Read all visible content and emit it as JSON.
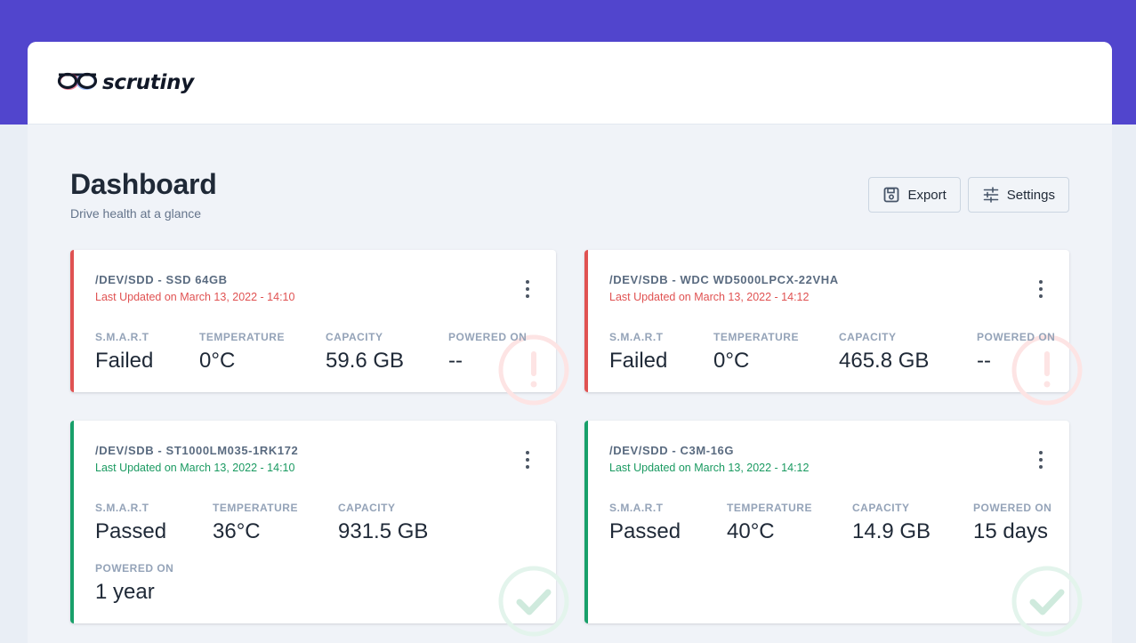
{
  "app": {
    "name": "scrutiny"
  },
  "page": {
    "title": "Dashboard",
    "subtitle": "Drive health at a glance"
  },
  "actions": {
    "export_label": "Export",
    "settings_label": "Settings"
  },
  "colors": {
    "brand": "#5145cd",
    "failed": "#e05252",
    "passed": "#18a06a"
  },
  "metric_labels": {
    "smart": "S.M.A.R.T",
    "temperature": "TEMPERATURE",
    "capacity": "CAPACITY",
    "powered_on": "POWERED ON"
  },
  "drives": [
    {
      "title": "/DEV/SDD - SSD 64GB",
      "updated": "Last Updated on March 13, 2022 - 14:10",
      "status": "failed",
      "smart": "Failed",
      "temperature": "0°C",
      "capacity": "59.6 GB",
      "powered_on": "--",
      "status_icon": "exclamation-icon"
    },
    {
      "title": "/DEV/SDB - WDC WD5000LPCX-22VHA",
      "updated": "Last Updated on March 13, 2022 - 14:12",
      "status": "failed",
      "smart": "Failed",
      "temperature": "0°C",
      "capacity": "465.8 GB",
      "powered_on": "--",
      "status_icon": "exclamation-icon"
    },
    {
      "title": "/DEV/SDB - ST1000LM035-1RK172",
      "updated": "Last Updated on March 13, 2022 - 14:10",
      "status": "passed",
      "smart": "Passed",
      "temperature": "36°C",
      "capacity": "931.5 GB",
      "powered_on": "1 year",
      "status_icon": "check-icon"
    },
    {
      "title": "/DEV/SDD - C3M-16G",
      "updated": "Last Updated on March 13, 2022 - 14:12",
      "status": "passed",
      "smart": "Passed",
      "temperature": "40°C",
      "capacity": "14.9 GB",
      "powered_on": "15 days",
      "status_icon": "check-icon"
    }
  ]
}
